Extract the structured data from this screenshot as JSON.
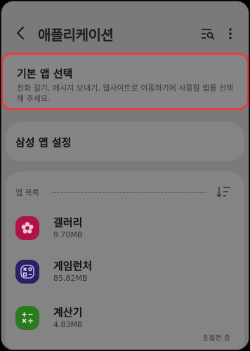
{
  "header": {
    "title": "애플리케이션",
    "icons": [
      "back-arrow-icon",
      "search-filter-icon",
      "more-vert-icon"
    ]
  },
  "default_apps": {
    "title": "기본 앱 선택",
    "subtitle": "전화 걸기, 메시지 보내기, 웹사이트로 이동하기에 사용할 앱을 선택해 주세요.",
    "highlight_color": "#e93b44"
  },
  "samsung_settings": {
    "label": "삼성 앱 설정"
  },
  "app_list": {
    "section_label": "앱 목록",
    "items": [
      {
        "name": "갤러리",
        "size": "9.70MB",
        "icon": "gallery-icon",
        "color": "#b0124a"
      },
      {
        "name": "게임런처",
        "size": "85.82MB",
        "icon": "game-launcher-icon",
        "color": "#2c1f63"
      },
      {
        "name": "계산기",
        "size": "4.83MB",
        "icon": "calculator-icon",
        "color": "#2b7a1f"
      }
    ],
    "footer_status": "초절전 중"
  }
}
